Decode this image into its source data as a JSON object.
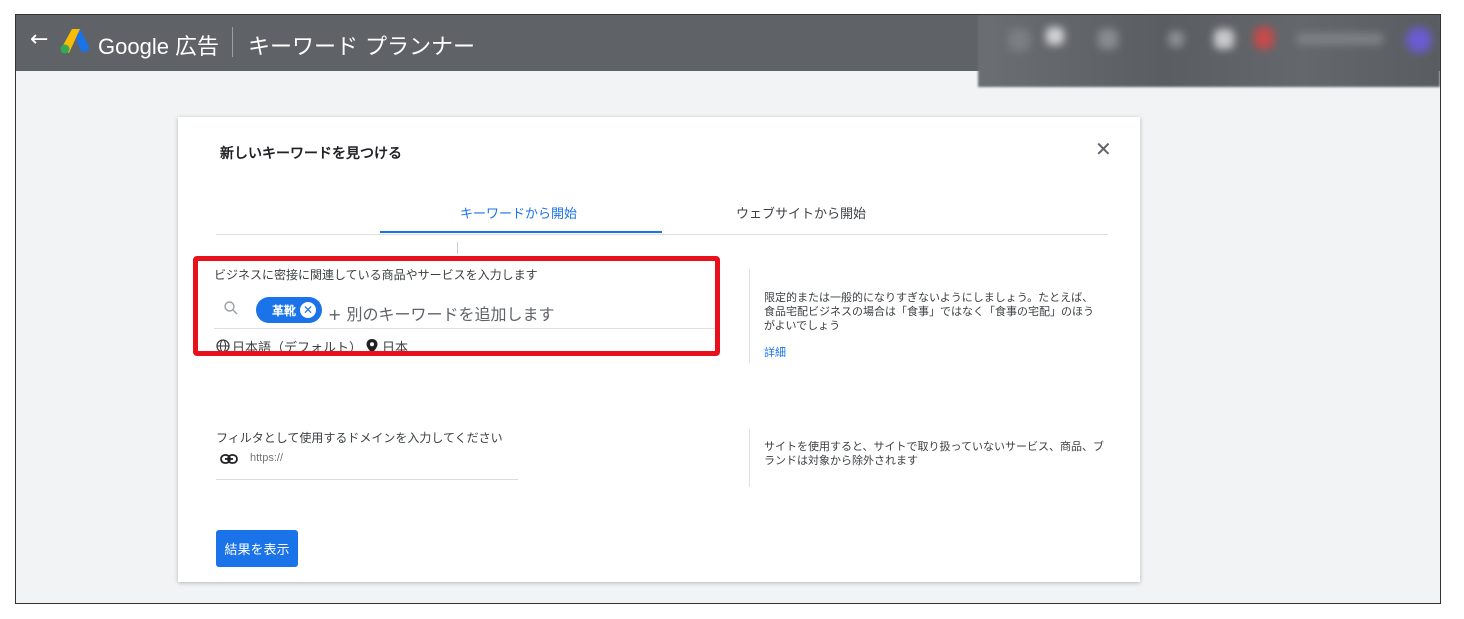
{
  "header": {
    "back_icon": "arrow-left-icon",
    "brand": "Google 広告",
    "title": "キーワード プランナー"
  },
  "dialog": {
    "title": "新しいキーワードを見つける",
    "close_icon": "close-icon",
    "tabs": [
      {
        "label": "キーワードから開始",
        "active": true
      },
      {
        "label": "ウェブサイトから開始",
        "active": false
      }
    ],
    "keyword_section": {
      "label": "ビジネスに密接に関連している商品やサービスを入力します",
      "chip": "革靴",
      "add_placeholder": "+ 別のキーワードを追加します",
      "language": "日本語（デフォルト）",
      "location": "日本"
    },
    "keyword_help": {
      "text": "限定的または一般的になりすぎないようにしましょう。たとえば、食品宅配ビジネスの場合は「食事」ではなく「食事の宅配」のほうがよいでしょう",
      "link": "詳細"
    },
    "domain_section": {
      "label": "フィルタとして使用するドメインを入力してください",
      "placeholder": "https://"
    },
    "domain_help": {
      "text": "サイトを使用すると、サイトで取り扱っていないサービス、商品、ブランドは対象から除外されます"
    },
    "submit_label": "結果を表示"
  },
  "colors": {
    "topbar": "#5f6368",
    "accent": "#1a73e8",
    "highlight_box": "#e8101a",
    "page_bg": "#f1f3f4"
  }
}
